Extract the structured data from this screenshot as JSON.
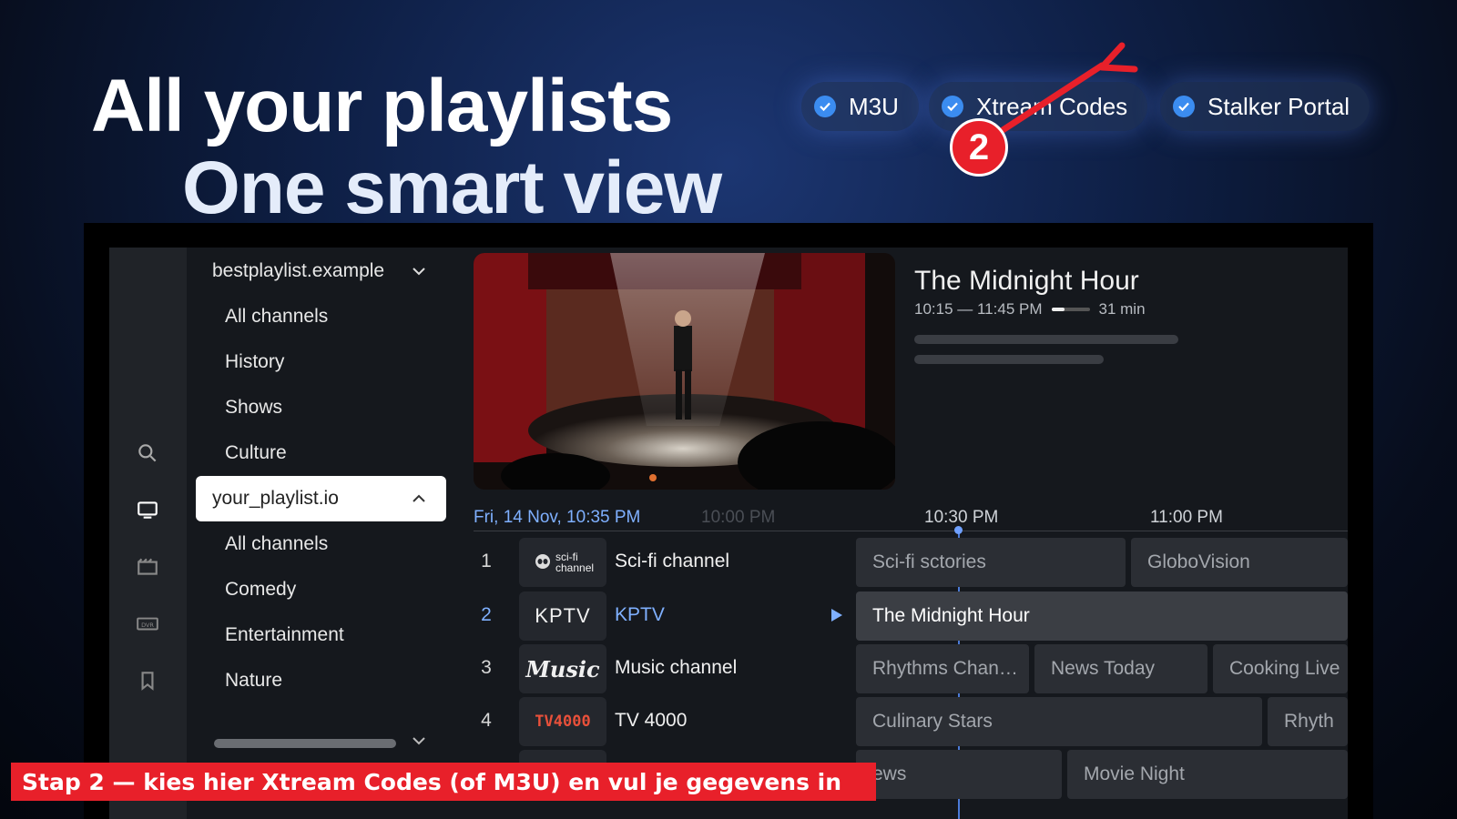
{
  "headline": {
    "line1": "All your playlists",
    "line2": "One smart view"
  },
  "formats": [
    {
      "label": "M3U"
    },
    {
      "label": "Xtream Codes"
    },
    {
      "label": "Stalker Portal"
    }
  ],
  "step_badge": "2",
  "caption": "Stap 2 — kies hier Xtream Codes (of M3U) en vul je gegevens in",
  "rail": {
    "icons": [
      "search-icon",
      "tv-icon",
      "movie-icon",
      "dvr-icon",
      "bookmark-icon"
    ],
    "active": "tv-icon"
  },
  "menu": {
    "playlists": [
      {
        "name": "bestplaylist.example",
        "items": [
          "All channels",
          "History",
          "Shows",
          "Culture"
        ]
      },
      {
        "name": "your_playlist.io",
        "items": [
          "All channels",
          "Comedy",
          "Entertainment",
          "Nature"
        ]
      }
    ]
  },
  "now_playing": {
    "title": "The Midnight Hour",
    "time_range": "10:15 — 11:45 PM",
    "remaining": "31 min",
    "progress": 0.35
  },
  "guide": {
    "date": "Fri,  14 Nov, 10:35 PM",
    "times": [
      "10:00 PM",
      "10:30 PM",
      "11:00 PM"
    ],
    "channels": [
      {
        "num": "1",
        "logo": "sci-fi channel",
        "name": "Sci-fi channel",
        "programs": [
          "Sci-fi sctories",
          "GloboVision"
        ]
      },
      {
        "num": "2",
        "logo": "KPTV",
        "name": "KPTV",
        "programs": [
          "The Midnight Hour"
        ]
      },
      {
        "num": "3",
        "logo": "Music",
        "name": "Music channel",
        "programs": [
          "Rhythms Chan…",
          "News Today",
          "Cooking Live"
        ]
      },
      {
        "num": "4",
        "logo": "TV4000",
        "name": "TV 4000",
        "programs": [
          "Culinary Stars",
          "Rhyth"
        ]
      },
      {
        "num": "",
        "logo": "",
        "name": "",
        "programs": [
          "ews",
          "Movie Night"
        ]
      }
    ]
  }
}
